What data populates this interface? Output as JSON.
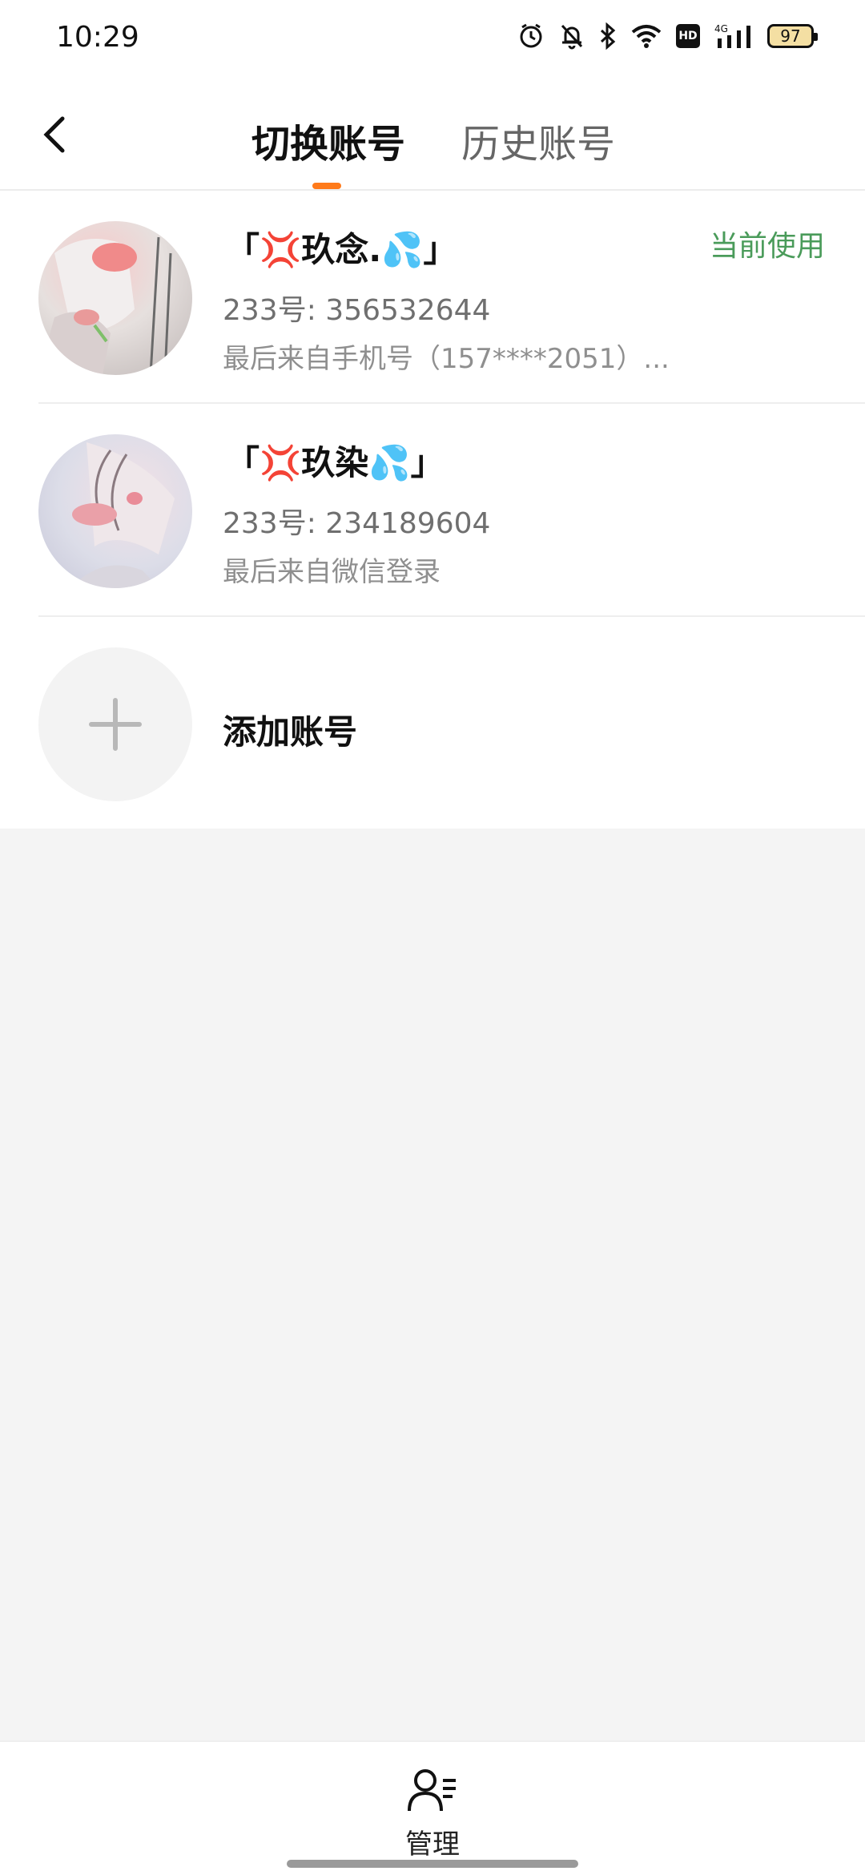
{
  "status_bar": {
    "time": "10:29",
    "battery": "97",
    "icons": [
      "alarm-icon",
      "bell-off-icon",
      "bluetooth-icon",
      "wifi-icon",
      "hd-icon",
      "signal-4g-icon",
      "battery-icon"
    ]
  },
  "header": {
    "back_icon": "chevron-left-icon",
    "tabs": [
      {
        "label": "切换账号",
        "active": true
      },
      {
        "label": "历史账号",
        "active": false
      }
    ]
  },
  "accounts": [
    {
      "name": "「💢玖念.💦」",
      "id_line": "233号: 356532644",
      "last_login": "最后来自手机号（157****2051）...",
      "badge": "当前使用"
    },
    {
      "name": "「💢玖染💦」",
      "id_line": "233号: 234189604",
      "last_login": "最后来自微信登录"
    }
  ],
  "add_account": {
    "label": "添加账号",
    "icon": "plus-icon"
  },
  "bottom": {
    "manage_label": "管理",
    "manage_icon": "user-list-icon"
  },
  "colors": {
    "accent": "#ff7a1a",
    "current_badge": "#4a9b5a",
    "background": "#f4f4f4"
  }
}
